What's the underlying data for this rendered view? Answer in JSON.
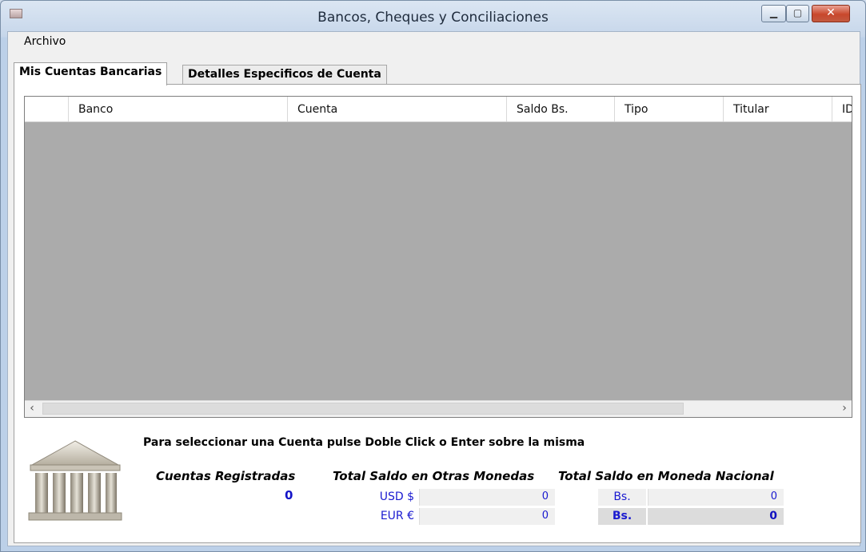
{
  "window": {
    "title": "Bancos, Cheques y Conciliaciones",
    "min_glyph": "▁",
    "max_glyph": "▢",
    "close_glyph": "✕"
  },
  "menu": {
    "items": [
      {
        "label": "Archivo"
      }
    ]
  },
  "tabs": [
    {
      "label": "Mis Cuentas Bancarias",
      "active": true
    },
    {
      "label": "Detalles Especificos de Cuenta",
      "active": false
    }
  ],
  "grid": {
    "columns": [
      "",
      "Banco",
      "Cuenta",
      "Saldo Bs.",
      "Tipo",
      "Titular",
      "ID"
    ],
    "rows": [],
    "scroll_left": "‹",
    "scroll_right": "›"
  },
  "hint": "Para seleccionar una Cuenta pulse Doble Click o Enter sobre la misma",
  "summary": {
    "cuentas_title": "Cuentas Registradas",
    "cuentas_count": "0",
    "otras_title": "Total Saldo en Otras Monedas",
    "nacional_title": "Total Saldo en Moneda Nacional",
    "usd_label": "USD $",
    "usd_value": "0",
    "eur_label": "EUR €",
    "eur_value": "0",
    "bs_label": "Bs.",
    "bs_value": "0",
    "bs_total_label": "Bs.",
    "bs_total_value": "0"
  },
  "icons": {
    "app": "app-icon",
    "bank": "bank-building-icon"
  },
  "colors": {
    "accent_blue": "#1a1ad0",
    "grid_bg": "#ababab"
  }
}
